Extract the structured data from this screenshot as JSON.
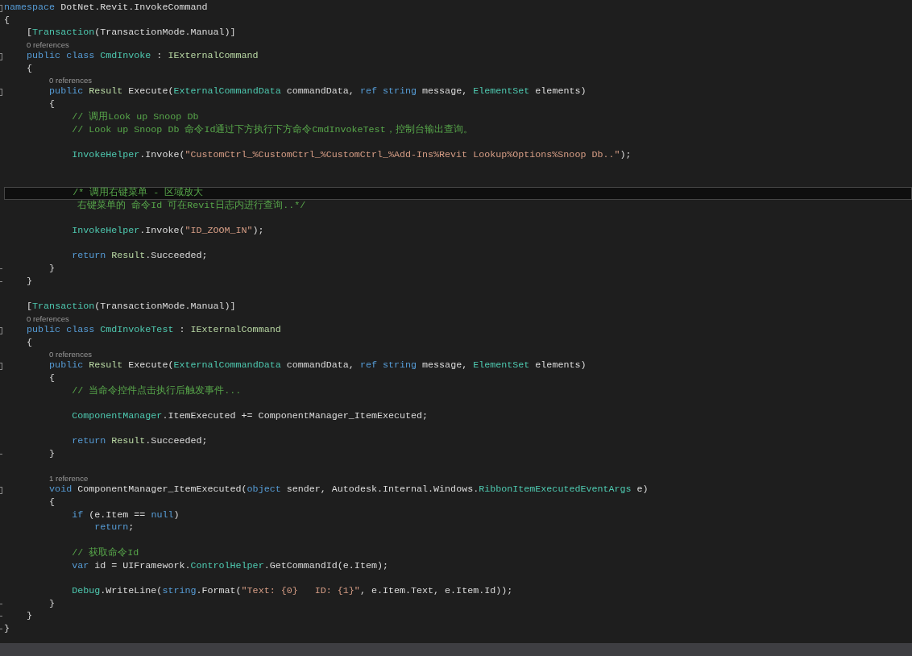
{
  "editor": {
    "lines": [
      {
        "kind": "code",
        "collapsible": true,
        "block_end": false,
        "current": false,
        "tokens": [
          {
            "text": "namespace",
            "kind": "kw"
          },
          {
            "text": " DotNet.Revit.InvokeCommand",
            "kind": "plain"
          }
        ]
      },
      {
        "kind": "code",
        "collapsible": false,
        "block_end": false,
        "current": false,
        "tokens": [
          {
            "text": "{",
            "kind": "plain"
          }
        ]
      },
      {
        "kind": "code",
        "collapsible": false,
        "block_end": false,
        "current": false,
        "tokens": [
          {
            "text": "    [",
            "kind": "plain"
          },
          {
            "text": "Transaction",
            "kind": "type"
          },
          {
            "text": "(TransactionMode.Manual)]",
            "kind": "plain"
          }
        ]
      },
      {
        "kind": "lens",
        "collapsible": false,
        "block_end": false,
        "current": false,
        "text": "    0 references"
      },
      {
        "kind": "code",
        "collapsible": true,
        "block_end": false,
        "current": false,
        "tokens": [
          {
            "text": "    public class",
            "kind": "kw"
          },
          {
            "text": " CmdInvoke",
            "kind": "type"
          },
          {
            "text": " : ",
            "kind": "plain"
          },
          {
            "text": "IExternalCommand",
            "kind": "enum"
          }
        ]
      },
      {
        "kind": "code",
        "collapsible": false,
        "block_end": false,
        "current": false,
        "tokens": [
          {
            "text": "    {",
            "kind": "plain"
          }
        ]
      },
      {
        "kind": "lens",
        "collapsible": false,
        "block_end": false,
        "current": false,
        "text": "        0 references"
      },
      {
        "kind": "code",
        "collapsible": true,
        "block_end": false,
        "current": false,
        "tokens": [
          {
            "text": "        public",
            "kind": "kw"
          },
          {
            "text": " Result",
            "kind": "enum"
          },
          {
            "text": " Execute(",
            "kind": "plain"
          },
          {
            "text": "ExternalCommandData",
            "kind": "type"
          },
          {
            "text": " commandData, ",
            "kind": "plain"
          },
          {
            "text": "ref string",
            "kind": "kw"
          },
          {
            "text": " message, ",
            "kind": "plain"
          },
          {
            "text": "ElementSet",
            "kind": "type"
          },
          {
            "text": " elements)",
            "kind": "plain"
          }
        ]
      },
      {
        "kind": "code",
        "collapsible": false,
        "block_end": false,
        "current": false,
        "tokens": [
          {
            "text": "        {",
            "kind": "plain"
          }
        ]
      },
      {
        "kind": "code",
        "collapsible": false,
        "block_end": false,
        "current": false,
        "tokens": [
          {
            "text": "            // 调用Look up Snoop Db",
            "kind": "comment"
          }
        ]
      },
      {
        "kind": "code",
        "collapsible": false,
        "block_end": false,
        "current": false,
        "tokens": [
          {
            "text": "            // Look up Snoop Db 命令Id通过下方执行下方命令CmdInvokeTest，控制台输出查询。",
            "kind": "comment"
          }
        ]
      },
      {
        "kind": "blank",
        "collapsible": false,
        "block_end": false,
        "current": false
      },
      {
        "kind": "code",
        "collapsible": false,
        "block_end": false,
        "current": false,
        "tokens": [
          {
            "text": "            InvokeHelper",
            "kind": "type"
          },
          {
            "text": ".Invoke(",
            "kind": "plain"
          },
          {
            "text": "\"CustomCtrl_%CustomCtrl_%CustomCtrl_%Add-Ins%Revit Lookup%Options%Snoop Db..\"",
            "kind": "str"
          },
          {
            "text": ");",
            "kind": "plain"
          }
        ]
      },
      {
        "kind": "blank",
        "collapsible": false,
        "block_end": false,
        "current": false
      },
      {
        "kind": "blank",
        "collapsible": false,
        "block_end": false,
        "current": false
      },
      {
        "kind": "code",
        "collapsible": false,
        "block_end": false,
        "current": true,
        "tokens": [
          {
            "text": "            /* 调用右键菜单 - 区域放大",
            "kind": "comment"
          }
        ]
      },
      {
        "kind": "code",
        "collapsible": false,
        "block_end": false,
        "current": false,
        "tokens": [
          {
            "text": "             右键菜单的 命令Id 可在Revit日志内进行查询..*/",
            "kind": "comment"
          }
        ]
      },
      {
        "kind": "blank",
        "collapsible": false,
        "block_end": false,
        "current": false
      },
      {
        "kind": "code",
        "collapsible": false,
        "block_end": false,
        "current": false,
        "tokens": [
          {
            "text": "            InvokeHelper",
            "kind": "type"
          },
          {
            "text": ".Invoke(",
            "kind": "plain"
          },
          {
            "text": "\"ID_ZOOM_IN\"",
            "kind": "str"
          },
          {
            "text": ");",
            "kind": "plain"
          }
        ]
      },
      {
        "kind": "blank",
        "collapsible": false,
        "block_end": false,
        "current": false
      },
      {
        "kind": "code",
        "collapsible": false,
        "block_end": false,
        "current": false,
        "tokens": [
          {
            "text": "            return",
            "kind": "kw"
          },
          {
            "text": " Result",
            "kind": "enum"
          },
          {
            "text": ".Succeeded;",
            "kind": "plain"
          }
        ]
      },
      {
        "kind": "code",
        "collapsible": false,
        "block_end": true,
        "current": false,
        "tokens": [
          {
            "text": "        }",
            "kind": "plain"
          }
        ]
      },
      {
        "kind": "code",
        "collapsible": false,
        "block_end": true,
        "current": false,
        "tokens": [
          {
            "text": "    }",
            "kind": "plain"
          }
        ]
      },
      {
        "kind": "blank",
        "collapsible": false,
        "block_end": false,
        "current": false
      },
      {
        "kind": "code",
        "collapsible": false,
        "block_end": false,
        "current": false,
        "tokens": [
          {
            "text": "    [",
            "kind": "plain"
          },
          {
            "text": "Transaction",
            "kind": "type"
          },
          {
            "text": "(TransactionMode.Manual)]",
            "kind": "plain"
          }
        ]
      },
      {
        "kind": "lens",
        "collapsible": false,
        "block_end": false,
        "current": false,
        "text": "    0 references"
      },
      {
        "kind": "code",
        "collapsible": true,
        "block_end": false,
        "current": false,
        "tokens": [
          {
            "text": "    public class",
            "kind": "kw"
          },
          {
            "text": " CmdInvokeTest",
            "kind": "type"
          },
          {
            "text": " : ",
            "kind": "plain"
          },
          {
            "text": "IExternalCommand",
            "kind": "enum"
          }
        ]
      },
      {
        "kind": "code",
        "collapsible": false,
        "block_end": false,
        "current": false,
        "tokens": [
          {
            "text": "    {",
            "kind": "plain"
          }
        ]
      },
      {
        "kind": "lens",
        "collapsible": false,
        "block_end": false,
        "current": false,
        "text": "        0 references"
      },
      {
        "kind": "code",
        "collapsible": true,
        "block_end": false,
        "current": false,
        "tokens": [
          {
            "text": "        public",
            "kind": "kw"
          },
          {
            "text": " Result",
            "kind": "enum"
          },
          {
            "text": " Execute(",
            "kind": "plain"
          },
          {
            "text": "ExternalCommandData",
            "kind": "type"
          },
          {
            "text": " commandData, ",
            "kind": "plain"
          },
          {
            "text": "ref string",
            "kind": "kw"
          },
          {
            "text": " message, ",
            "kind": "plain"
          },
          {
            "text": "ElementSet",
            "kind": "type"
          },
          {
            "text": " elements)",
            "kind": "plain"
          }
        ]
      },
      {
        "kind": "code",
        "collapsible": false,
        "block_end": false,
        "current": false,
        "tokens": [
          {
            "text": "        {",
            "kind": "plain"
          }
        ]
      },
      {
        "kind": "code",
        "collapsible": false,
        "block_end": false,
        "current": false,
        "tokens": [
          {
            "text": "            // 当命令控件点击执行后触发事件...",
            "kind": "comment"
          }
        ]
      },
      {
        "kind": "blank",
        "collapsible": false,
        "block_end": false,
        "current": false
      },
      {
        "kind": "code",
        "collapsible": false,
        "block_end": false,
        "current": false,
        "tokens": [
          {
            "text": "            ComponentManager",
            "kind": "type"
          },
          {
            "text": ".ItemExecuted += ComponentManager_ItemExecuted;",
            "kind": "plain"
          }
        ]
      },
      {
        "kind": "blank",
        "collapsible": false,
        "block_end": false,
        "current": false
      },
      {
        "kind": "code",
        "collapsible": false,
        "block_end": false,
        "current": false,
        "tokens": [
          {
            "text": "            return",
            "kind": "kw"
          },
          {
            "text": " Result",
            "kind": "enum"
          },
          {
            "text": ".Succeeded;",
            "kind": "plain"
          }
        ]
      },
      {
        "kind": "code",
        "collapsible": false,
        "block_end": true,
        "current": false,
        "tokens": [
          {
            "text": "        }",
            "kind": "plain"
          }
        ]
      },
      {
        "kind": "blank",
        "collapsible": false,
        "block_end": false,
        "current": false
      },
      {
        "kind": "lens",
        "collapsible": false,
        "block_end": false,
        "current": false,
        "text": "        1 reference"
      },
      {
        "kind": "code",
        "collapsible": true,
        "block_end": false,
        "current": false,
        "tokens": [
          {
            "text": "        void",
            "kind": "kw"
          },
          {
            "text": " ComponentManager_ItemExecuted(",
            "kind": "plain"
          },
          {
            "text": "object",
            "kind": "kw"
          },
          {
            "text": " sender, Autodesk.Internal.Windows.",
            "kind": "plain"
          },
          {
            "text": "RibbonItemExecutedEventArgs",
            "kind": "type"
          },
          {
            "text": " e)",
            "kind": "plain"
          }
        ]
      },
      {
        "kind": "code",
        "collapsible": false,
        "block_end": false,
        "current": false,
        "tokens": [
          {
            "text": "        {",
            "kind": "plain"
          }
        ]
      },
      {
        "kind": "code",
        "collapsible": false,
        "block_end": false,
        "current": false,
        "tokens": [
          {
            "text": "            if",
            "kind": "kw"
          },
          {
            "text": " (e.Item == ",
            "kind": "plain"
          },
          {
            "text": "null",
            "kind": "kw"
          },
          {
            "text": ")",
            "kind": "plain"
          }
        ]
      },
      {
        "kind": "code",
        "collapsible": false,
        "block_end": false,
        "current": false,
        "tokens": [
          {
            "text": "                return",
            "kind": "kw"
          },
          {
            "text": ";",
            "kind": "plain"
          }
        ]
      },
      {
        "kind": "blank",
        "collapsible": false,
        "block_end": false,
        "current": false
      },
      {
        "kind": "code",
        "collapsible": false,
        "block_end": false,
        "current": false,
        "tokens": [
          {
            "text": "            // 获取命令Id",
            "kind": "comment"
          }
        ]
      },
      {
        "kind": "code",
        "collapsible": false,
        "block_end": false,
        "current": false,
        "tokens": [
          {
            "text": "            var",
            "kind": "kw"
          },
          {
            "text": " id = UIFramework.",
            "kind": "plain"
          },
          {
            "text": "ControlHelper",
            "kind": "type"
          },
          {
            "text": ".GetCommandId(e.Item);",
            "kind": "plain"
          }
        ]
      },
      {
        "kind": "blank",
        "collapsible": false,
        "block_end": false,
        "current": false
      },
      {
        "kind": "code",
        "collapsible": false,
        "block_end": false,
        "current": false,
        "tokens": [
          {
            "text": "            Debug",
            "kind": "type"
          },
          {
            "text": ".WriteLine(",
            "kind": "plain"
          },
          {
            "text": "string",
            "kind": "kw"
          },
          {
            "text": ".Format(",
            "kind": "plain"
          },
          {
            "text": "\"Text: {0}   ID: {1}\"",
            "kind": "str"
          },
          {
            "text": ", e.Item.Text, e.Item.Id));",
            "kind": "plain"
          }
        ]
      },
      {
        "kind": "code",
        "collapsible": false,
        "block_end": true,
        "current": false,
        "tokens": [
          {
            "text": "        }",
            "kind": "plain"
          }
        ]
      },
      {
        "kind": "code",
        "collapsible": false,
        "block_end": true,
        "current": false,
        "tokens": [
          {
            "text": "    }",
            "kind": "plain"
          }
        ]
      },
      {
        "kind": "code",
        "collapsible": false,
        "block_end": true,
        "current": false,
        "tokens": [
          {
            "text": "}",
            "kind": "plain"
          }
        ]
      }
    ]
  }
}
